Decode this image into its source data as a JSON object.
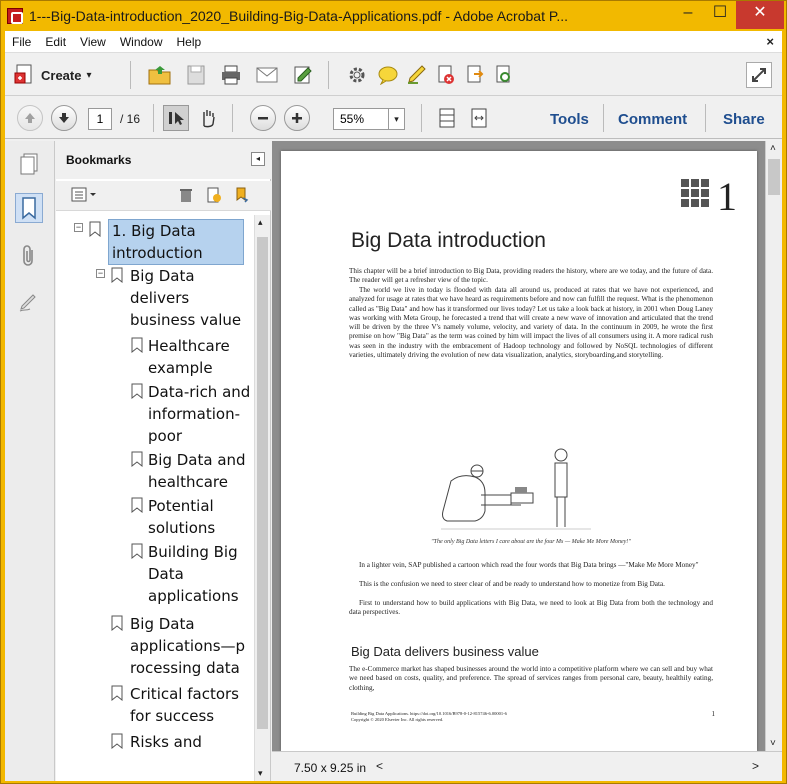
{
  "window": {
    "title": "1---Big-Data-introduction_2020_Building-Big-Data-Applications.pdf - Adobe Acrobat P...",
    "min_label": "–",
    "max_label": "☐",
    "close_label": "✕"
  },
  "menu": {
    "items": [
      "File",
      "Edit",
      "View",
      "Window",
      "Help"
    ],
    "close_label": "×"
  },
  "toolbar": {
    "create_label": "Create",
    "create_arrow": "▾",
    "page_current": "1",
    "page_total": "/ 16",
    "zoom_value": "55%",
    "zoom_arrow": "▾",
    "tools_label": "Tools",
    "comment_label": "Comment",
    "share_label": "Share"
  },
  "bookmarks": {
    "title": "Bookmarks",
    "collapse_label": "◂",
    "items": [
      {
        "label": "1. Big Data\nintroduction"
      },
      {
        "label": "Big Data\ndelivers\nbusiness value"
      },
      {
        "label": "Healthcare\nexample"
      },
      {
        "label": "Data-rich and\ninformation-\npoor"
      },
      {
        "label": "Big Data and\nhealthcare"
      },
      {
        "label": "Potential\nsolutions"
      },
      {
        "label": "Building Big\nData\napplications"
      },
      {
        "label": "Big Data\napplications—p\nrocessing data"
      },
      {
        "label": "Critical factors\nfor success"
      },
      {
        "label": "Risks and"
      }
    ],
    "toggle_minus": "−"
  },
  "document": {
    "chapter_number": "1",
    "heading": "Big Data introduction",
    "para1": "This chapter will be a brief introduction to Big Data, providing readers the history, where are we today, and the future of data. The reader will get a refresher view of the topic.",
    "para2": "The world we live in today is flooded with data all around us, produced at rates that we have not experienced, and analyzed for usage at rates that we have heard as requirements before and now can fulfill the request. What is the phenomenon called as \"Big Data\" and how has it transformed our lives today? Let us take a look back at history, in 2001 when Doug Laney was working with Meta Group, he forecasted a trend that will create a new wave of innovation and articulated that the trend will be driven by the three V's namely volume, velocity, and variety of data. In the continuum in 2009, he wrote the first premise on how \"Big Data\" as the term was coined by him will impact the lives of all consumers using it. A more radical rush was seen in the industry with the embracement of Hadoop technology and followed by NoSQL technologies of different varieties, ultimately driving the evolution of new data visualization, analytics, storyboarding,and storytelling.",
    "caption": "\"The only Big Data letters I care about are the four Ms — Make Me More Money!\"",
    "para3": "In a lighter vein, SAP published a cartoon which read the four words that Big Data brings —\"Make Me More Money\"",
    "para4": "This is the confusion we need to steer clear of and be ready to understand how to monetize from Big Data.",
    "para5": "First to understand how to build applications with Big Data, we need to look at Big Data from both the technology and data perspectives.",
    "subheading": "Big Data delivers business value",
    "para6": "The e-Commerce market has shaped businesses around the world into a competitive platform where we can sell and buy what we need based on costs, quality, and preference. The spread of services ranges from personal care, beauty, healthily eating, clothing,",
    "footer_line1": "Building Big Data Applications. https://doi.org/10.1016/B978-0-12-815746-6.00001-6",
    "footer_line2": "Copyright © 2020 Elsevier Inc. All rights reserved.",
    "page_number": "1",
    "page_size": "7.50 x 9.25 in"
  }
}
